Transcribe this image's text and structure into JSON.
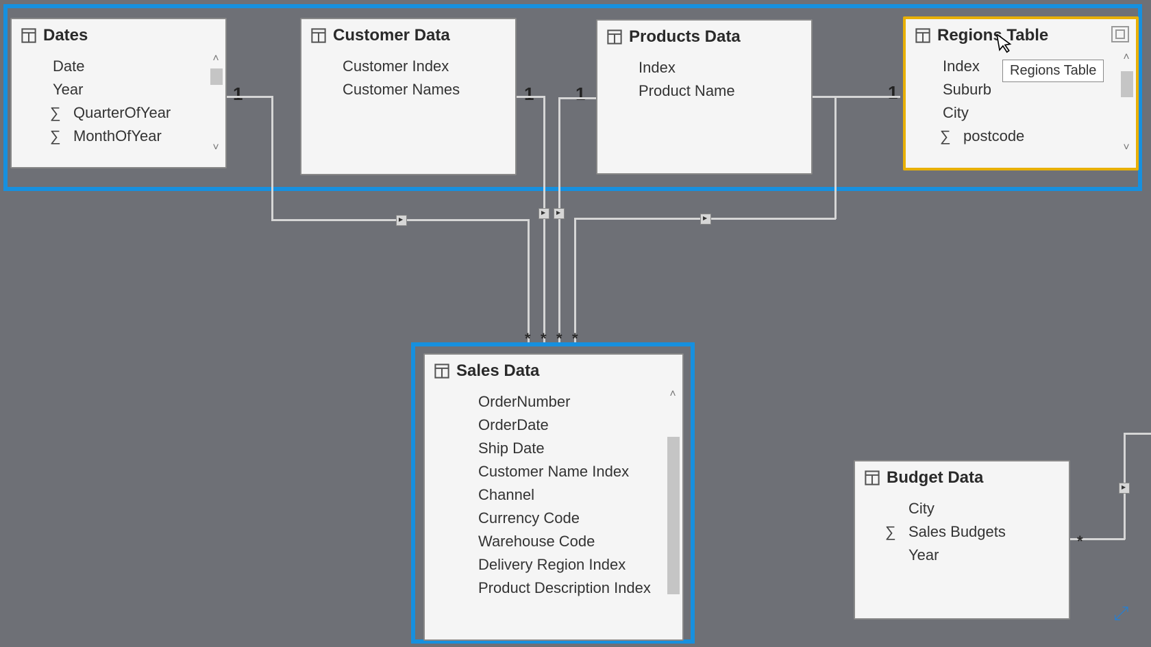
{
  "tables": {
    "dates": {
      "title": "Dates",
      "fields": [
        "Date",
        "Year",
        "QuarterOfYear",
        "MonthOfYear"
      ],
      "sigma_fields": [
        2,
        3
      ]
    },
    "customer": {
      "title": "Customer Data",
      "fields": [
        "Customer Index",
        "Customer Names"
      ]
    },
    "products": {
      "title": "Products Data",
      "fields": [
        "Index",
        "Product Name"
      ]
    },
    "regions": {
      "title": "Regions Table",
      "fields": [
        "Index",
        "Suburb",
        "City",
        "postcode"
      ],
      "sigma_fields": [
        3
      ],
      "tooltip": "Regions Table"
    },
    "sales": {
      "title": "Sales Data",
      "fields": [
        "OrderNumber",
        "OrderDate",
        "Ship Date",
        "Customer Name Index",
        "Channel",
        "Currency Code",
        "Warehouse Code",
        "Delivery Region Index",
        "Product Description Index"
      ]
    },
    "budget": {
      "title": "Budget Data",
      "fields": [
        "City",
        "Sales Budgets",
        "Year"
      ],
      "sigma_fields": [
        1
      ]
    }
  },
  "cardinality": {
    "dates_one": "1",
    "customer_one": "1",
    "products_one": "1",
    "regions_one": "1",
    "many1": "*",
    "many2": "*",
    "many3": "*",
    "many4": "*",
    "budget_many": "*"
  }
}
